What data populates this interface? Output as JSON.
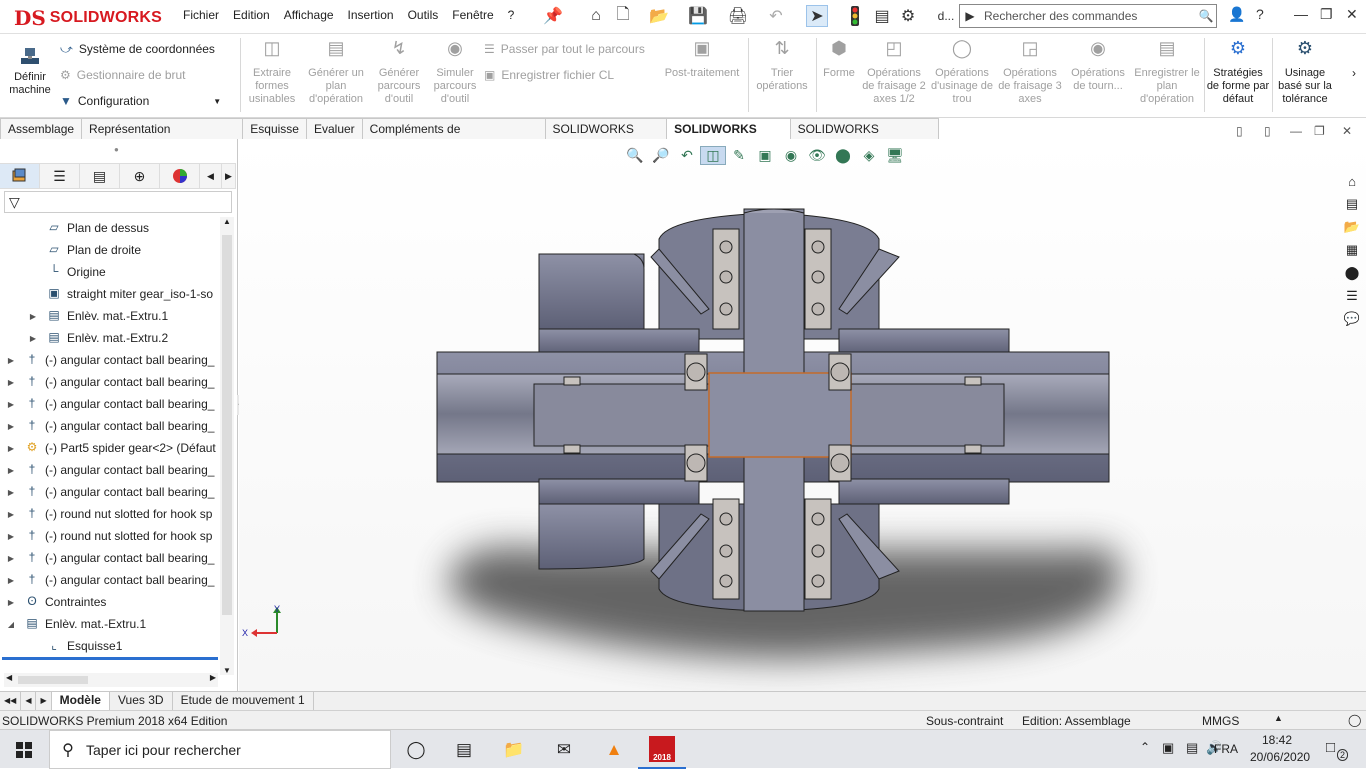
{
  "app": {
    "logo_ds": "DS",
    "logo_text": "SOLIDWORKS"
  },
  "menu": [
    "Fichier",
    "Edition",
    "Affichage",
    "Insertion",
    "Outils",
    "Fenêtre",
    "?"
  ],
  "toolbar": {
    "doc_label": "d...",
    "search_placeholder": "Rechercher des commandes"
  },
  "ribbon": {
    "define_machine": "Définir machine",
    "coord_system": "Système de coordonnées",
    "stock_manager": "Gestionnaire de brut",
    "configuration": "Configuration",
    "extract": "Extraire formes usinables",
    "generate_plan": "Générer un plan d'opération",
    "generate_paths": "Générer parcours d'outil",
    "simulate": "Simuler parcours d'outil",
    "step_through": "Passer par tout le parcours",
    "save_cl": "Enregistrer fichier CL",
    "post": "Post-traitement",
    "sort": "Trier opérations",
    "shape": "Forme",
    "mill25": "Opérations de fraisage 2 axes 1/2",
    "hole": "Opérations d'usinage de trou",
    "mill3": "Opérations de fraisage 3 axes",
    "turn": "Opérations de tourn...",
    "save_plan": "Enregistrer le plan d'opération",
    "strategies": "Stratégies de forme par défaut",
    "tolerance": "Usinage basé sur la tolérance"
  },
  "tabs": [
    "Assemblage",
    "Représentation schématique",
    "Esquisse",
    "Evaluer",
    "Compléments de SOLIDWORKS",
    "SOLIDWORKS MBD",
    "SOLIDWORKS CAM",
    "SOLIDWORKS Inspection"
  ],
  "active_tab": "SOLIDWORKS CAM",
  "tree": [
    {
      "label": "Plan de dessus",
      "icon": "plane-icon",
      "indent": 2,
      "expander": false
    },
    {
      "label": "Plan de droite",
      "icon": "plane-icon",
      "indent": 2,
      "expander": false
    },
    {
      "label": "Origine",
      "icon": "origin-icon",
      "indent": 2,
      "expander": false
    },
    {
      "label": "straight miter gear_iso-1-so",
      "icon": "part-icon",
      "indent": 2,
      "expander": false
    },
    {
      "label": "Enlèv. mat.-Extru.1",
      "icon": "cut-extrude-icon",
      "indent": 2,
      "expander": true
    },
    {
      "label": "Enlèv. mat.-Extru.2",
      "icon": "cut-extrude-icon",
      "indent": 2,
      "expander": true
    },
    {
      "label": "(-) angular contact ball bearing_",
      "icon": "bearing-icon",
      "indent": 1,
      "expander": true
    },
    {
      "label": "(-) angular contact ball bearing_",
      "icon": "bearing-icon",
      "indent": 1,
      "expander": true
    },
    {
      "label": "(-) angular contact ball bearing_",
      "icon": "bearing-icon",
      "indent": 1,
      "expander": true
    },
    {
      "label": "(-) angular contact ball bearing_",
      "icon": "bearing-icon",
      "indent": 1,
      "expander": true
    },
    {
      "label": "(-) Part5 spider gear<2> (Défaut",
      "icon": "gear-part-icon",
      "indent": 1,
      "expander": true
    },
    {
      "label": "(-) angular contact ball bearing_",
      "icon": "bearing-icon",
      "indent": 1,
      "expander": true
    },
    {
      "label": "(-) angular contact ball bearing_",
      "icon": "bearing-icon",
      "indent": 1,
      "expander": true
    },
    {
      "label": "(-) round nut slotted for hook sp",
      "icon": "bearing-icon",
      "indent": 1,
      "expander": true
    },
    {
      "label": "(-) round nut slotted for hook sp",
      "icon": "bearing-icon",
      "indent": 1,
      "expander": true
    },
    {
      "label": "(-) angular contact ball bearing_",
      "icon": "bearing-icon",
      "indent": 1,
      "expander": true
    },
    {
      "label": "(-) angular contact ball bearing_",
      "icon": "bearing-icon",
      "indent": 1,
      "expander": true
    },
    {
      "label": "Contraintes",
      "icon": "mates-icon",
      "indent": 1,
      "expander": true
    },
    {
      "label": "Enlèv. mat.-Extru.1",
      "icon": "cut-extrude-icon",
      "indent": 1,
      "expander": "open"
    },
    {
      "label": "Esquisse1",
      "icon": "sketch-icon",
      "indent": 2,
      "expander": false
    }
  ],
  "bottom_tabs": [
    "Modèle",
    "Vues 3D",
    "Etude de mouvement 1"
  ],
  "status": {
    "edition": "SOLIDWORKS Premium 2018 x64 Edition",
    "constraint": "Sous-contraint",
    "editing": "Edition: Assemblage",
    "units": "MMGS"
  },
  "triad": {
    "x": "X",
    "y": "Y"
  },
  "taskbar": {
    "search_placeholder": "Taper ici pour rechercher",
    "lang": "FRA",
    "time": "18:42",
    "date": "20/06/2020",
    "notifications": "2",
    "sw_badge": "2018"
  }
}
